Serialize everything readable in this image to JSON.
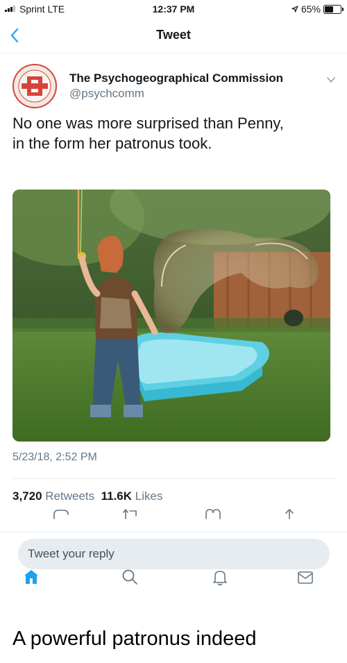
{
  "status_bar": {
    "carrier": "Sprint  LTE",
    "time": "12:37 PM",
    "battery": "65%",
    "battery_level": 0.65,
    "icons": [
      "signal-icon",
      "location-arrow-icon",
      "battery-icon"
    ]
  },
  "nav": {
    "title": "Tweet",
    "back_icon": "chevron-left-icon"
  },
  "tweet": {
    "author_name": "The Psychogeographical Commission",
    "author_handle": "@psychcomm",
    "text_lines": [
      "No one was more surprised than Penny,",
      "in the form her patronus took."
    ],
    "timestamp": "5/23/18, 2:52 PM",
    "retweets_count": "3,720",
    "retweets_label": "Retweets",
    "likes_count": "11.6K",
    "likes_label": "Likes",
    "actions": [
      "reply-icon",
      "retweet-icon",
      "like-icon",
      "share-icon"
    ]
  },
  "reply": {
    "placeholder": "Tweet your reply"
  },
  "tab_bar": [
    "home-icon",
    "search-icon",
    "notifications-icon",
    "messages-icon"
  ],
  "caption": "A powerful patronus indeed",
  "colors": {
    "accent": "#1da1f2",
    "secondary_text": "#657786",
    "divider": "#e6ecf0",
    "avatar_red": "#d6453d"
  }
}
